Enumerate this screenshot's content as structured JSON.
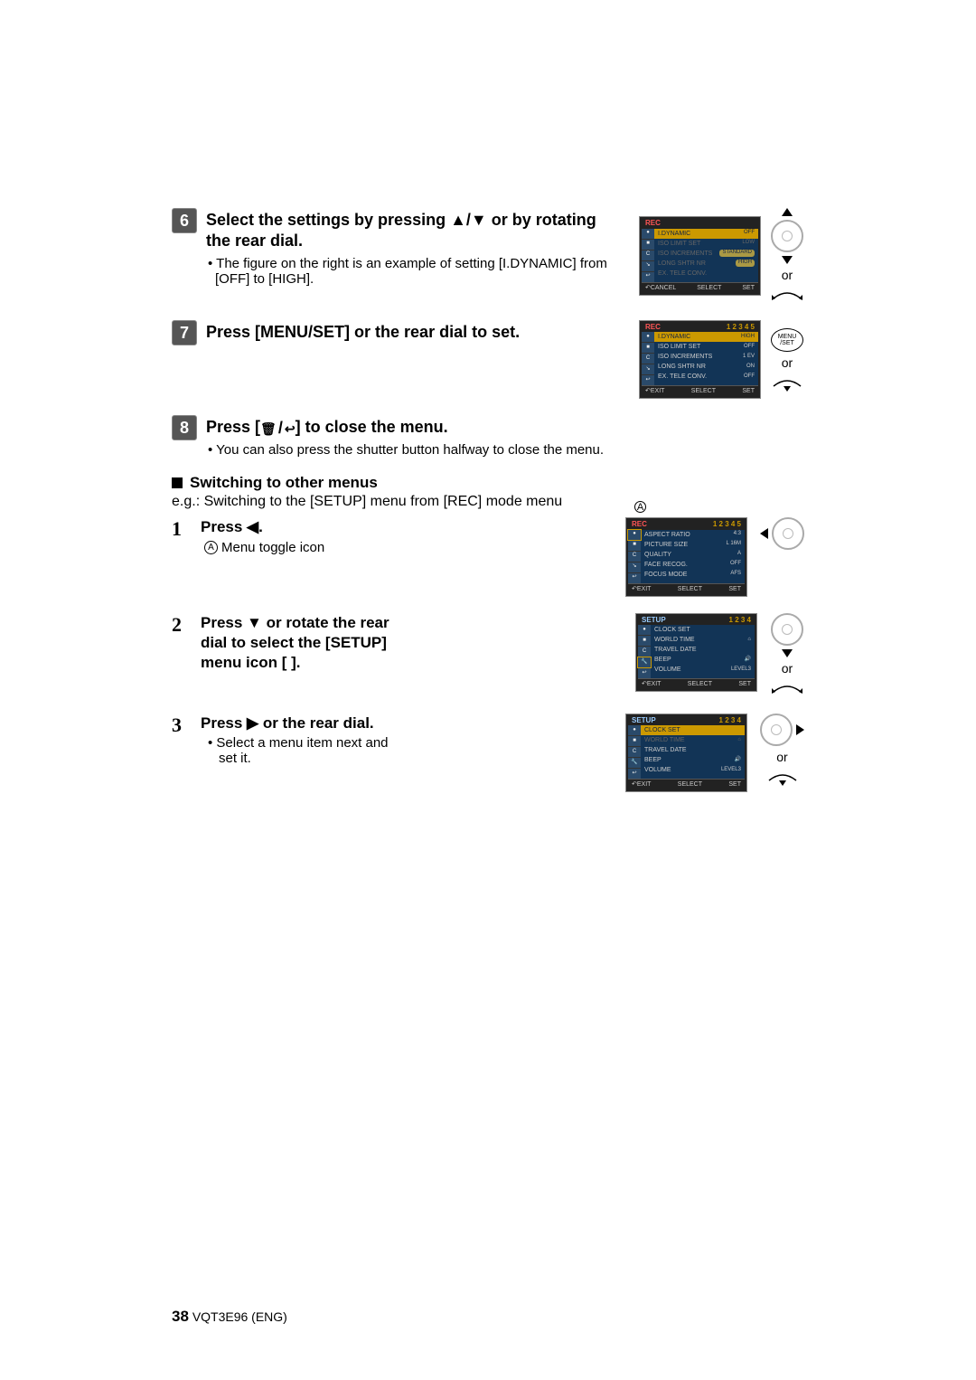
{
  "step6": {
    "title_a": "Select the settings by pressing ",
    "title_b": " or by rotating the rear dial.",
    "note": "The figure on the right is an example of setting [I.DYNAMIC] from [OFF] to [HIGH].",
    "or": "or",
    "lcd": {
      "header": "REC",
      "rows": [
        {
          "label": "I.DYNAMIC",
          "val": "OFF",
          "sel": true,
          "dim": false
        },
        {
          "label": "ISO LIMIT SET",
          "val": "LOW",
          "dim": true
        },
        {
          "label": "ISO INCREMENTS",
          "val": "STANDARD",
          "dim": true,
          "pill": true
        },
        {
          "label": "LONG SHTR NR",
          "val": "HIGH",
          "dim": true,
          "pill": true
        },
        {
          "label": "EX. TELE CONV.",
          "val": "",
          "dim": true
        }
      ],
      "footer_l": "CANCEL",
      "footer_m": "SELECT",
      "footer_r": "SET"
    }
  },
  "step7": {
    "title": "Press [MENU/SET] or the rear dial to set.",
    "or": "or",
    "menuset_top": "MENU",
    "menuset_bot": "/SET",
    "lcd": {
      "header": "REC",
      "page": "1 2 3 4 5",
      "rows": [
        {
          "label": "I.DYNAMIC",
          "val": "HIGH",
          "sel": true
        },
        {
          "label": "ISO LIMIT SET",
          "val": "OFF"
        },
        {
          "label": "ISO INCREMENTS",
          "val": "1 EV"
        },
        {
          "label": "LONG SHTR NR",
          "val": "ON"
        },
        {
          "label": "EX. TELE CONV.",
          "val": "OFF"
        }
      ],
      "footer_l": "EXIT",
      "footer_m": "SELECT",
      "footer_r": "SET"
    }
  },
  "step8": {
    "title_a": "Press [",
    "title_b": "] to close the menu.",
    "note": "You can also press the shutter button halfway to close the menu."
  },
  "switching": {
    "heading": "Switching to other menus",
    "eg": "e.g.: Switching to the [SETUP] menu from [REC] mode menu",
    "annA": "A",
    "s1": {
      "n": "1",
      "t": "Press ",
      "t2": ".",
      "sub_label": "Menu toggle icon",
      "lcd": {
        "header": "REC",
        "page": "1 2 3 4 5",
        "rows": [
          {
            "label": "ASPECT RATIO",
            "val": "4:3"
          },
          {
            "label": "PICTURE SIZE",
            "val": "L 16M"
          },
          {
            "label": "QUALITY",
            "val": "A"
          },
          {
            "label": "FACE RECOG.",
            "val": "OFF"
          },
          {
            "label": "FOCUS MODE",
            "val": "AFS"
          }
        ],
        "footer_l": "EXIT",
        "footer_m": "SELECT",
        "footer_r": "SET"
      }
    },
    "s2": {
      "n": "2",
      "t": "Press ▼ or rotate the rear dial to select the [SETUP] menu icon [    ].",
      "or": "or",
      "lcd": {
        "header": "SETUP",
        "page": "1 2 3 4",
        "rows": [
          {
            "label": "CLOCK SET",
            "val": ""
          },
          {
            "label": "WORLD TIME",
            "val": "⌂"
          },
          {
            "label": "TRAVEL DATE",
            "val": ""
          },
          {
            "label": "BEEP",
            "val": "🔊"
          },
          {
            "label": "VOLUME",
            "val": "LEVEL3"
          }
        ],
        "footer_l": "EXIT",
        "footer_m": "SELECT",
        "footer_r": "SET"
      }
    },
    "s3": {
      "n": "3",
      "t": "Press ▶ or the rear dial.",
      "sub": "Select a menu item next and set it.",
      "or": "or",
      "lcd": {
        "header": "SETUP",
        "page": "1 2 3 4",
        "rows": [
          {
            "label": "CLOCK SET",
            "val": "",
            "sel": true
          },
          {
            "label": "WORLD TIME",
            "val": "⌂",
            "dim": true
          },
          {
            "label": "TRAVEL DATE",
            "val": ""
          },
          {
            "label": "BEEP",
            "val": "🔊"
          },
          {
            "label": "VOLUME",
            "val": "LEVEL3"
          }
        ],
        "footer_l": "EXIT",
        "footer_m": "SELECT",
        "footer_r": "SET"
      }
    }
  },
  "footer": {
    "page": "38",
    "code": "VQT3E96 (ENG)"
  }
}
